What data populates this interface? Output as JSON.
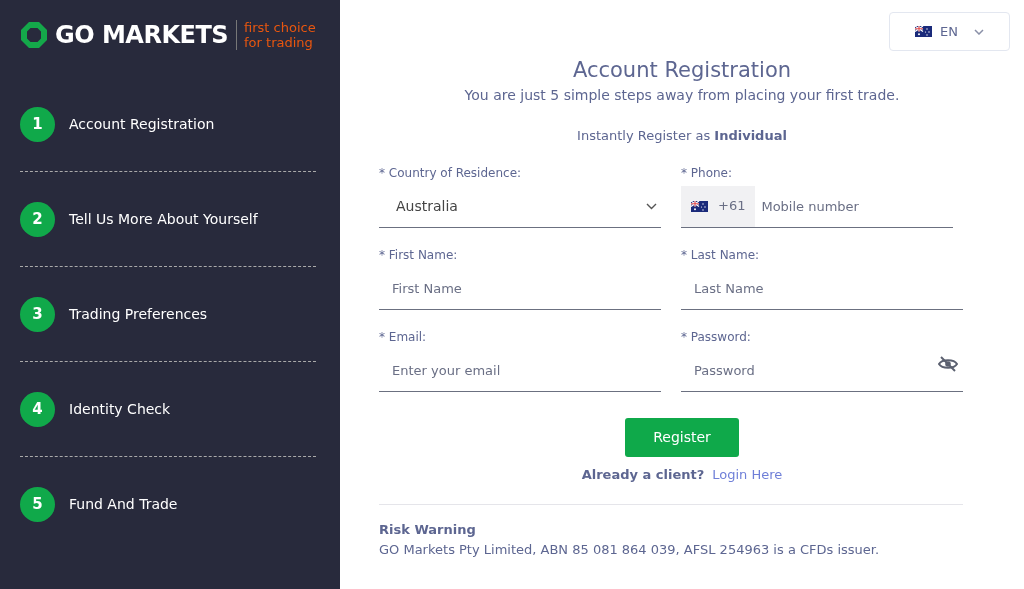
{
  "brand": {
    "name": "GO MARKETS",
    "tagline_line_1": "first choice",
    "tagline_line_2": "for trading"
  },
  "steps": [
    {
      "number": "1",
      "label": "Account Registration"
    },
    {
      "number": "2",
      "label": "Tell Us More About Yourself"
    },
    {
      "number": "3",
      "label": "Trading Preferences"
    },
    {
      "number": "4",
      "label": "Identity Check"
    },
    {
      "number": "5",
      "label": "Fund And Trade"
    }
  ],
  "language": {
    "code": "EN"
  },
  "title": "Account Registration",
  "subtitle": "You are just 5 simple steps away from placing your first trade.",
  "register_as": "Instantly Register as **Individual**",
  "fields": [
    {
      "kind": "select",
      "label": "* Country of Residence:",
      "value": "Australia"
    },
    {
      "kind": "phone",
      "label": "* Phone:",
      "prefix": "+61",
      "placeholder": "Mobile number"
    },
    {
      "kind": "text",
      "label": "* First Name:",
      "placeholder": "First Name"
    },
    {
      "kind": "text",
      "label": "* Last Name:",
      "placeholder": "Last Name"
    },
    {
      "kind": "text",
      "label": "* Email:",
      "placeholder": "Enter your email"
    },
    {
      "kind": "password",
      "label": "* Password:",
      "placeholder": "Password"
    }
  ],
  "register_button": "Register",
  "login_prompt": "Already a client?",
  "login_link": "Login Here",
  "risk_warning": {
    "title": "Risk Warning",
    "text": "GO Markets Pty Limited, ABN 85 081 864 039, AFSL 254963 is a CFDs issuer."
  }
}
